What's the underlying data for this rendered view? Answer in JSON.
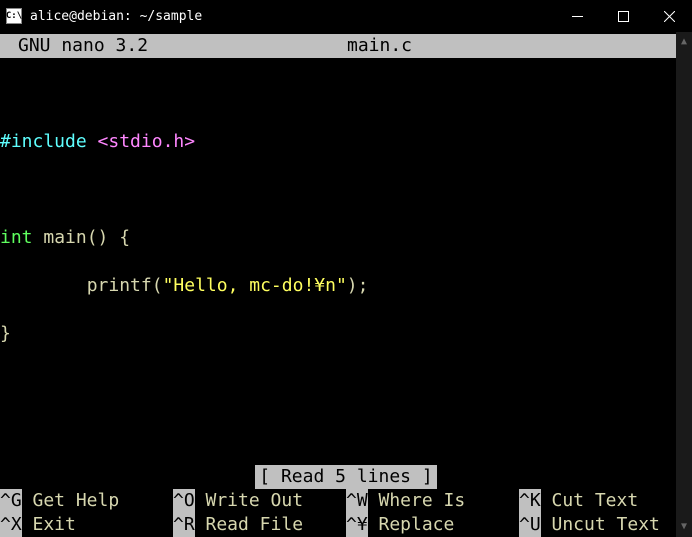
{
  "window": {
    "title": "alice@debian: ~/sample"
  },
  "nano": {
    "version_label": "GNU nano 3.2",
    "filename": "main.c",
    "status": "[ Read 5 lines ]"
  },
  "code": {
    "l1_pre": "#include ",
    "l1_hdr": "<stdio.h>",
    "l2": "",
    "l3_type": "int",
    "l3_rest": " main() {",
    "l4_indent": "        printf(",
    "l4_str": "\"Hello, mc-do!¥n\"",
    "l4_end": ");",
    "l5": "}"
  },
  "hotkeys": [
    {
      "key": "^G",
      "label": "Get Help"
    },
    {
      "key": "^O",
      "label": "Write Out"
    },
    {
      "key": "^W",
      "label": "Where Is"
    },
    {
      "key": "^K",
      "label": "Cut Text"
    },
    {
      "key": "^X",
      "label": "Exit"
    },
    {
      "key": "^R",
      "label": "Read File"
    },
    {
      "key": "^¥",
      "label": "Replace"
    },
    {
      "key": "^U",
      "label": "Uncut Text"
    }
  ]
}
